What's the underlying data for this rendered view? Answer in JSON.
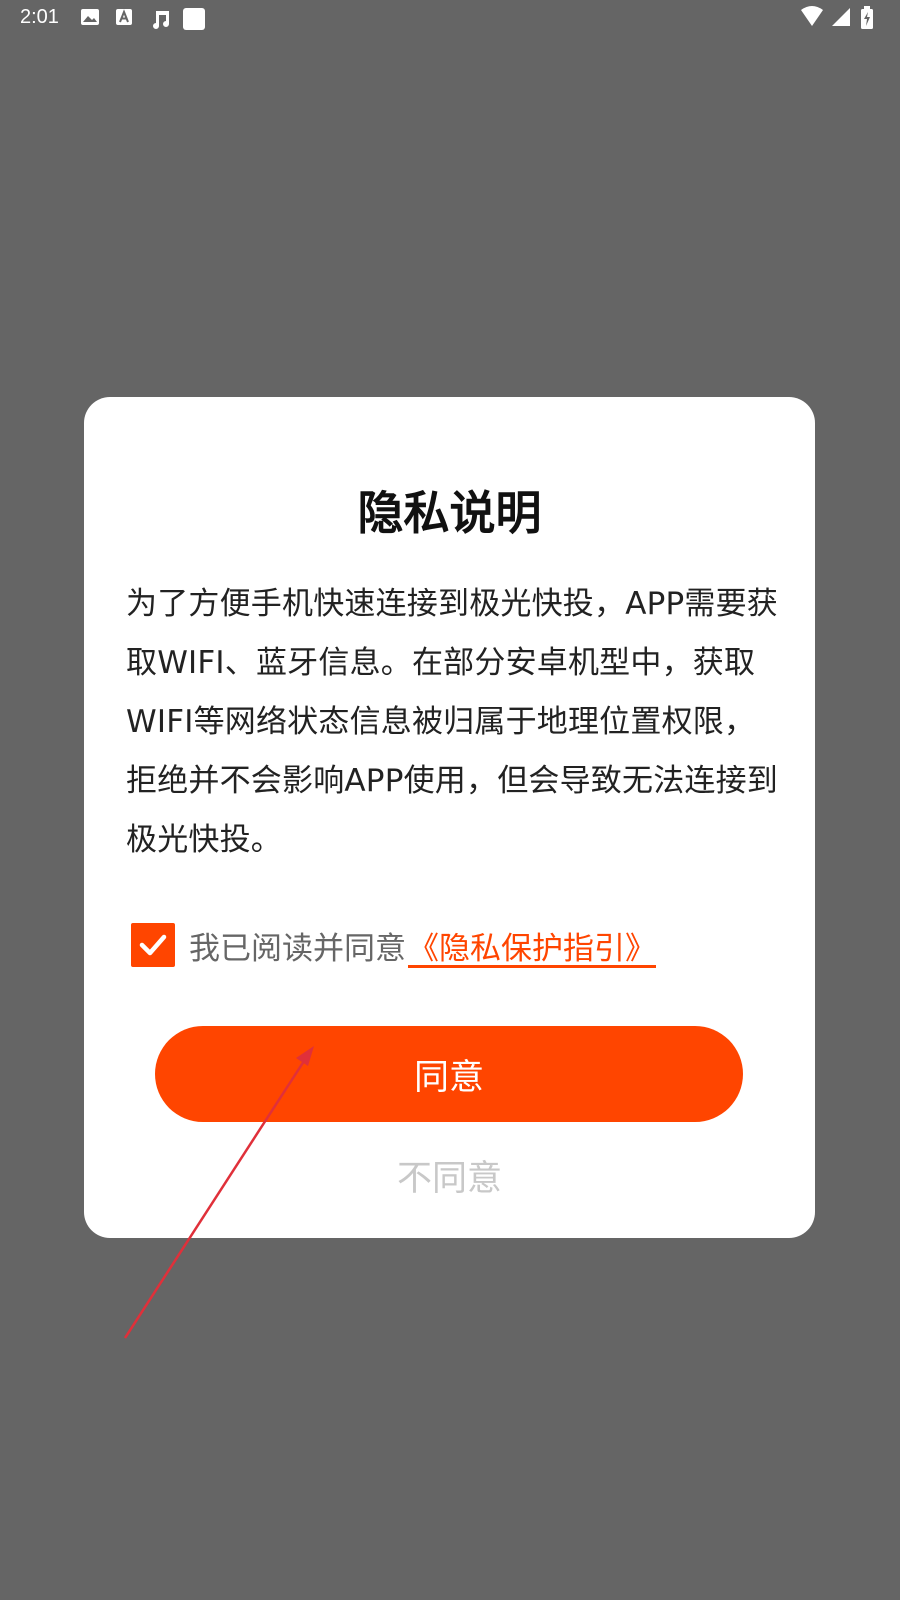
{
  "status_bar": {
    "time": "2:01",
    "left_icons": [
      "image-icon",
      "font-a-icon",
      "music-note-icon",
      "blank-square-icon"
    ],
    "right_icons": [
      "wifi-icon",
      "cellular-signal-icon",
      "battery-charging-icon"
    ]
  },
  "dialog": {
    "title": "隐私说明",
    "body": "为了方便手机快速连接到极光快投，APP需要获取WIFI、蓝牙信息。在部分安卓机型中，获取WIFI等网络状态信息被归属于地理位置权限，拒绝并不会影响APP使用，但会导致无法连接到极光快投。",
    "consent": {
      "checked": true,
      "text": "我已阅读并同意",
      "link_text": "《隐私保护指引》"
    },
    "agree_label": "同意",
    "disagree_label": "不同意"
  },
  "colors": {
    "accent": "#ff4500",
    "overlay": "#656565",
    "annotation_arrow": "#e0303a"
  }
}
